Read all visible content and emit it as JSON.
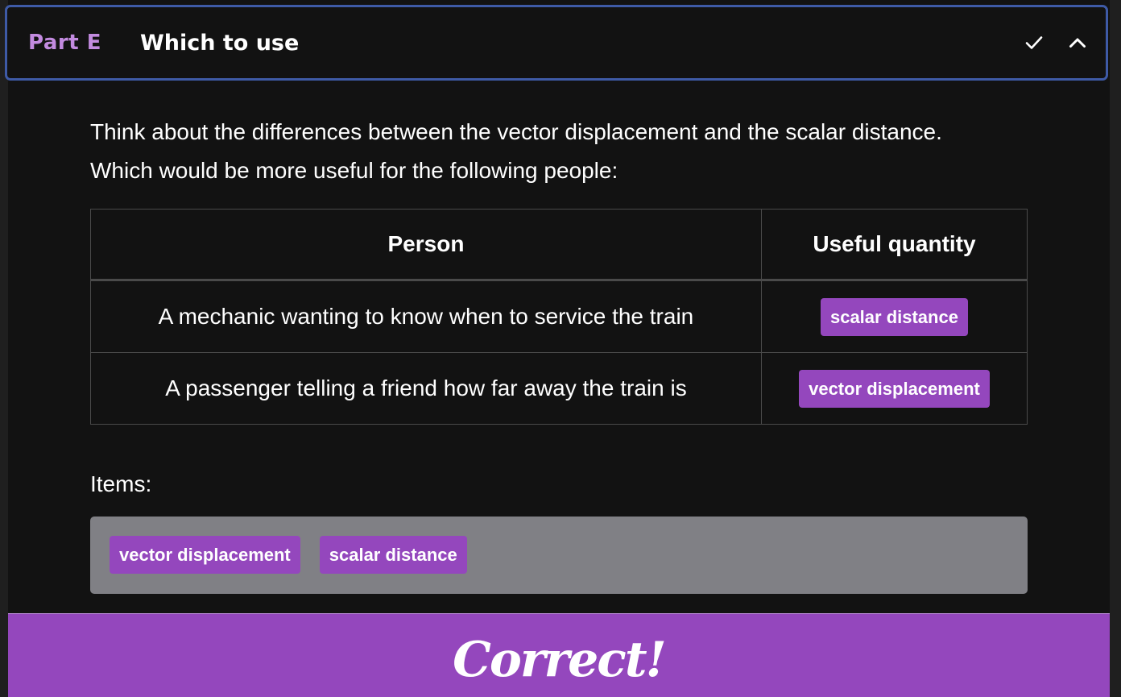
{
  "header": {
    "part_label": "Part E",
    "title": "Which to use",
    "icons": [
      "check-icon",
      "chevron-up-icon"
    ]
  },
  "prompt": {
    "line1": "Think about the differences between the vector displacement and the scalar distance.",
    "line2": "Which would be more useful for the following people:"
  },
  "table": {
    "headers": [
      "Person",
      "Useful quantity"
    ],
    "rows": [
      {
        "person": "A mechanic wanting to know when to service the train",
        "answer": "scalar distance"
      },
      {
        "person": "A passenger telling a friend how far away the train is",
        "answer": "vector displacement"
      }
    ]
  },
  "items": {
    "label": "Items:",
    "chips": [
      "vector displacement",
      "scalar distance"
    ]
  },
  "feedback": {
    "text": "Correct!"
  },
  "colors": {
    "accent": "#9447bd",
    "part_label": "#c38be0",
    "header_border": "#3e5aa6",
    "background": "#121212",
    "items_box": "#808085"
  }
}
